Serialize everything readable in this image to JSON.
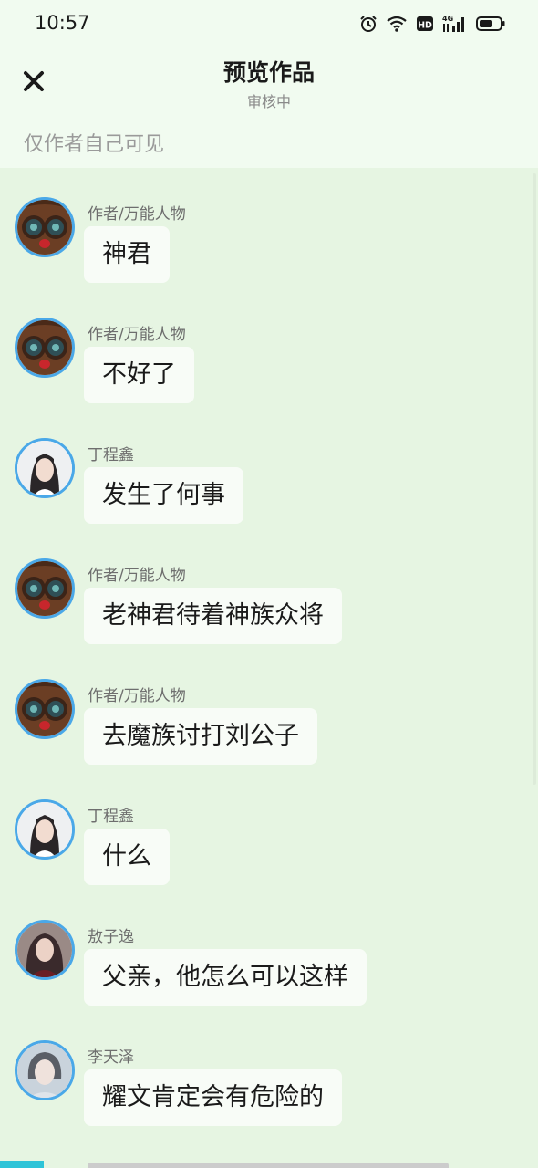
{
  "status_bar": {
    "time": "10:57",
    "network_label": "4G",
    "hd_label": "HD"
  },
  "header": {
    "title": "预览作品",
    "subtitle": "审核中",
    "close_icon": "close-icon",
    "visibility_note": "仅作者自己可见"
  },
  "colors": {
    "background": "#e6f5e2",
    "header_background": "#f1fbf0",
    "bubble": "#f8fcf7",
    "avatar_ring": "#4aa8e8"
  },
  "messages": [
    {
      "sender": "作者/万能人物",
      "text": "神君",
      "avatar": "cartoon-mask-avatar"
    },
    {
      "sender": "作者/万能人物",
      "text": "不好了",
      "avatar": "cartoon-mask-avatar"
    },
    {
      "sender": "丁程鑫",
      "text": "发生了何事",
      "avatar": "ding-chengxin-avatar"
    },
    {
      "sender": "作者/万能人物",
      "text": "老神君待着神族众将",
      "avatar": "cartoon-mask-avatar"
    },
    {
      "sender": "作者/万能人物",
      "text": "去魔族讨打刘公子",
      "avatar": "cartoon-mask-avatar"
    },
    {
      "sender": "丁程鑫",
      "text": "什么",
      "avatar": "ding-chengxin-avatar"
    },
    {
      "sender": "敖子逸",
      "text": "父亲，他怎么可以这样",
      "avatar": "ao-ziyi-avatar"
    },
    {
      "sender": "李天泽",
      "text": "耀文肯定会有危险的",
      "avatar": "li-tianze-avatar"
    }
  ]
}
